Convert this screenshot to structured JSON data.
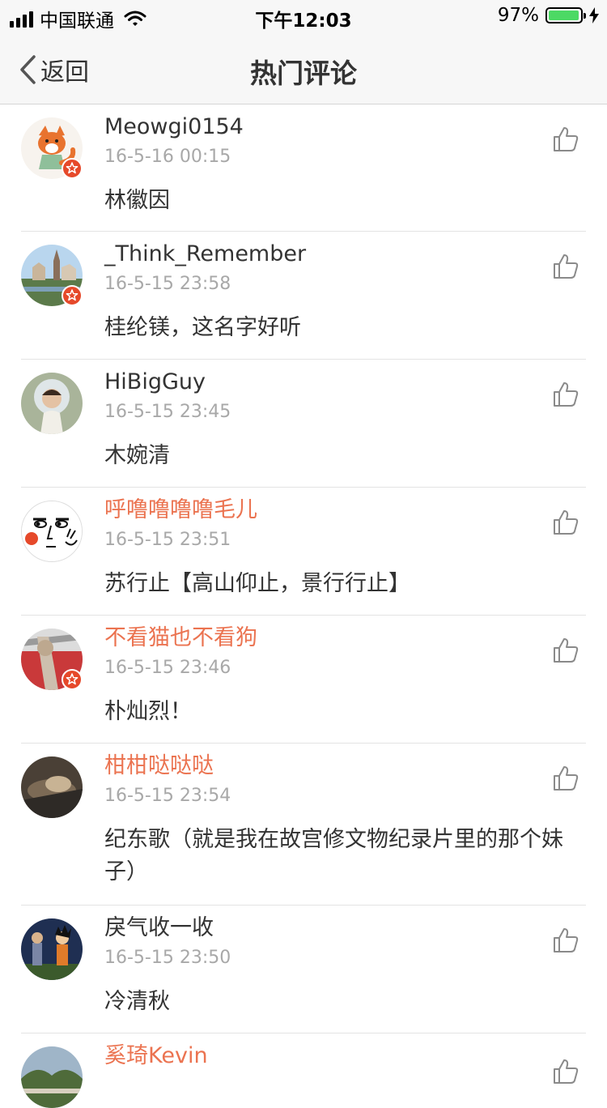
{
  "status_bar": {
    "carrier": "中国联通",
    "time": "下午12:03",
    "battery_percent": "97%",
    "battery_level": 0.97
  },
  "nav": {
    "back_label": "返回",
    "title": "热门评论"
  },
  "comments": [
    {
      "username": "Meowgi0154",
      "time": "16-5-16 00:15",
      "text": "林徽因"
    },
    {
      "username": "_Think_Remember",
      "time": "16-5-15 23:58",
      "text": "桂纶镁，这名字好听"
    },
    {
      "username": "HiBigGuy",
      "time": "16-5-15 23:45",
      "text": "木婉清"
    },
    {
      "username": "呼噜噜噜噜毛儿",
      "time": "16-5-15 23:51",
      "text": "苏行止【高山仰止，景行行止】"
    },
    {
      "username": "不看猫也不看狗",
      "time": "16-5-15 23:46",
      "text": "朴灿烈！"
    },
    {
      "username": "柑柑哒哒哒",
      "time": "16-5-15 23:54",
      "text": "纪东歌（就是我在故宫修文物纪录片里的那个妹子）"
    },
    {
      "username": "戾气收一收",
      "time": "16-5-15 23:50",
      "text": "冷清秋"
    },
    {
      "username": "奚琦Kevin",
      "time": "",
      "text": ""
    }
  ],
  "colors": {
    "vip_name": "#eb7350",
    "normal_name": "#333333",
    "timestamp": "#a8a8a8",
    "badge": "#e6492a"
  }
}
